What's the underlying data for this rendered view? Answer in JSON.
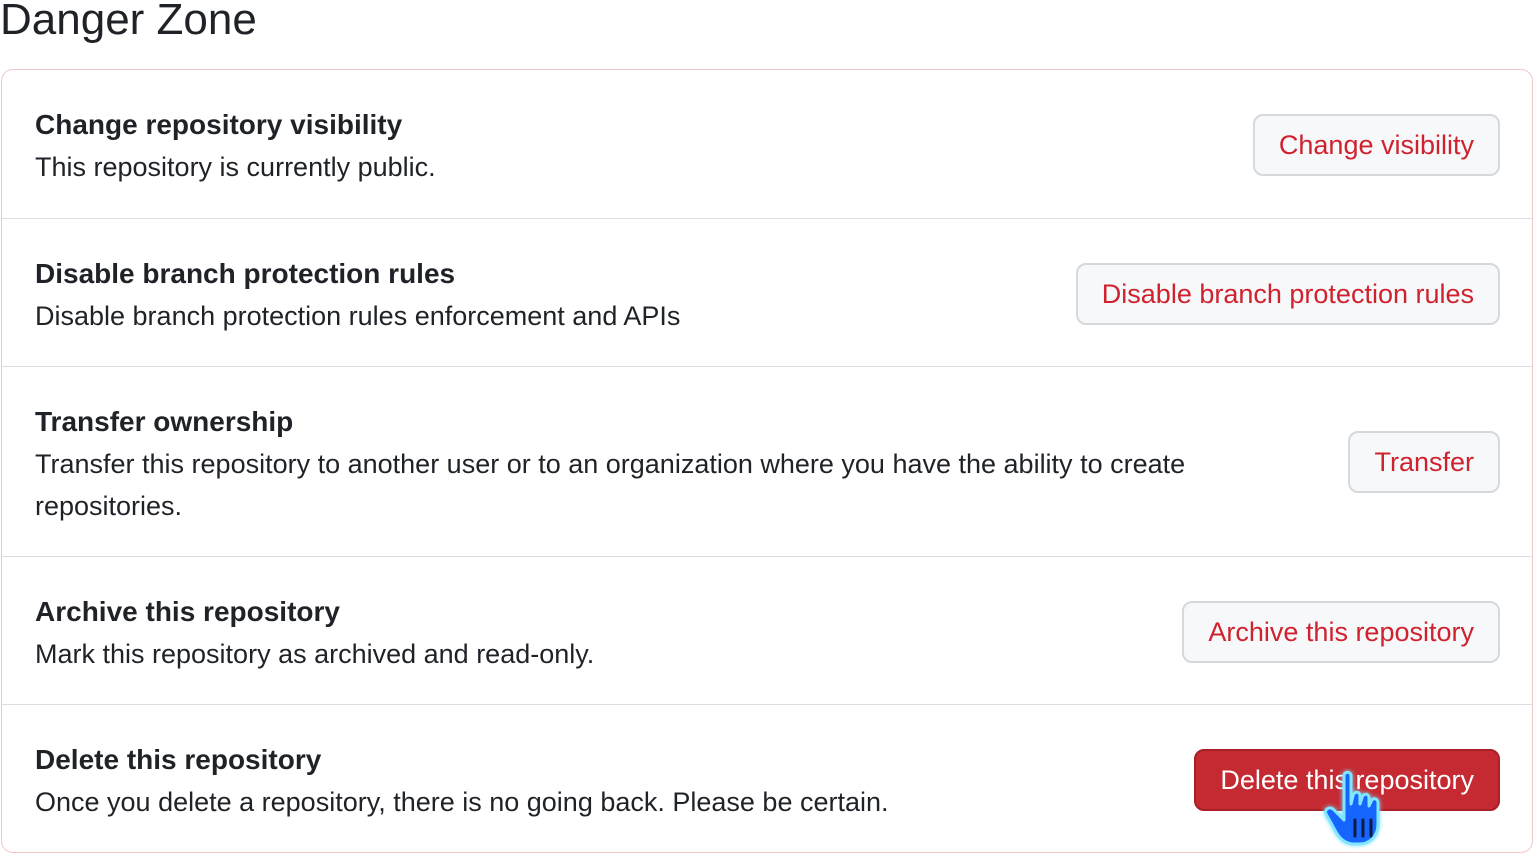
{
  "title": "Danger Zone",
  "rows": [
    {
      "title": "Change repository visibility",
      "description": "This repository is currently public.",
      "button": "Change visibility"
    },
    {
      "title": "Disable branch protection rules",
      "description": "Disable branch protection rules enforcement and APIs",
      "button": "Disable branch protection rules"
    },
    {
      "title": "Transfer ownership",
      "description": "Transfer this repository to another user or to an organization where you have the ability to create repositories.",
      "button": "Transfer"
    },
    {
      "title": "Archive this repository",
      "description": "Mark this repository as archived and read-only.",
      "button": "Archive this repository"
    },
    {
      "title": "Delete this repository",
      "description": "Once you delete a repository, there is no going back. Please be certain.",
      "button": "Delete this repository"
    }
  ],
  "colors": {
    "danger_text": "#cf222e",
    "danger_fill": "#c52a32",
    "box_border": "#f3c7c7",
    "cursor": "#1565ff"
  },
  "cursor_icon": "hand-pointer-icon"
}
